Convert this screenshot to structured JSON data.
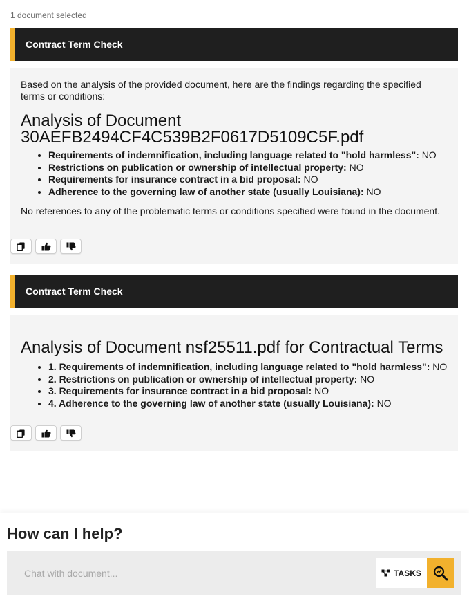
{
  "selection": {
    "count_text": "1 document selected"
  },
  "results": [
    {
      "header": "Contract Term Check",
      "intro": "Based on the analysis of the provided document, here are the findings regarding the specified terms or conditions:",
      "title": "Analysis of Document 30AEFB2494CF4C539B2F0617D5109C5F.pdf",
      "findings": [
        {
          "term": "Requirements of indemnification, including language related to \"hold harmless\":",
          "value": "NO"
        },
        {
          "term": "Restrictions on publication or ownership of intellectual property:",
          "value": "NO"
        },
        {
          "term": "Requirements for insurance contract in a bid proposal:",
          "value": "NO"
        },
        {
          "term": "Adherence to the governing law of another state (usually Louisiana):",
          "value": "NO"
        }
      ],
      "summary": "No references to any of the problematic terms or conditions specified were found in the document."
    },
    {
      "header": "Contract Term Check",
      "title": "Analysis of Document nsf25511.pdf for Contractual Terms",
      "findings": [
        {
          "term": "1. Requirements of indemnification, including language related to \"hold harmless\":",
          "value": "NO"
        },
        {
          "term": "2. Restrictions on publication or ownership of intellectual property:",
          "value": "NO"
        },
        {
          "term": "3. Requirements for insurance contract in a bid proposal:",
          "value": "NO"
        },
        {
          "term": "4. Adherence to the governing law of another state (usually Louisiana):",
          "value": "NO"
        }
      ]
    }
  ],
  "feedback_icons": [
    "copy-icon",
    "thumbs-up-icon",
    "thumbs-down-icon"
  ],
  "help": {
    "title": "How can I help?",
    "placeholder": "Chat with document...",
    "tasks_label": "TASKS"
  },
  "colors": {
    "accent": "#f2b12d",
    "header_bg": "#1f1f1f",
    "card_bg": "#f4f4f4",
    "chat_bg": "#ececec"
  }
}
